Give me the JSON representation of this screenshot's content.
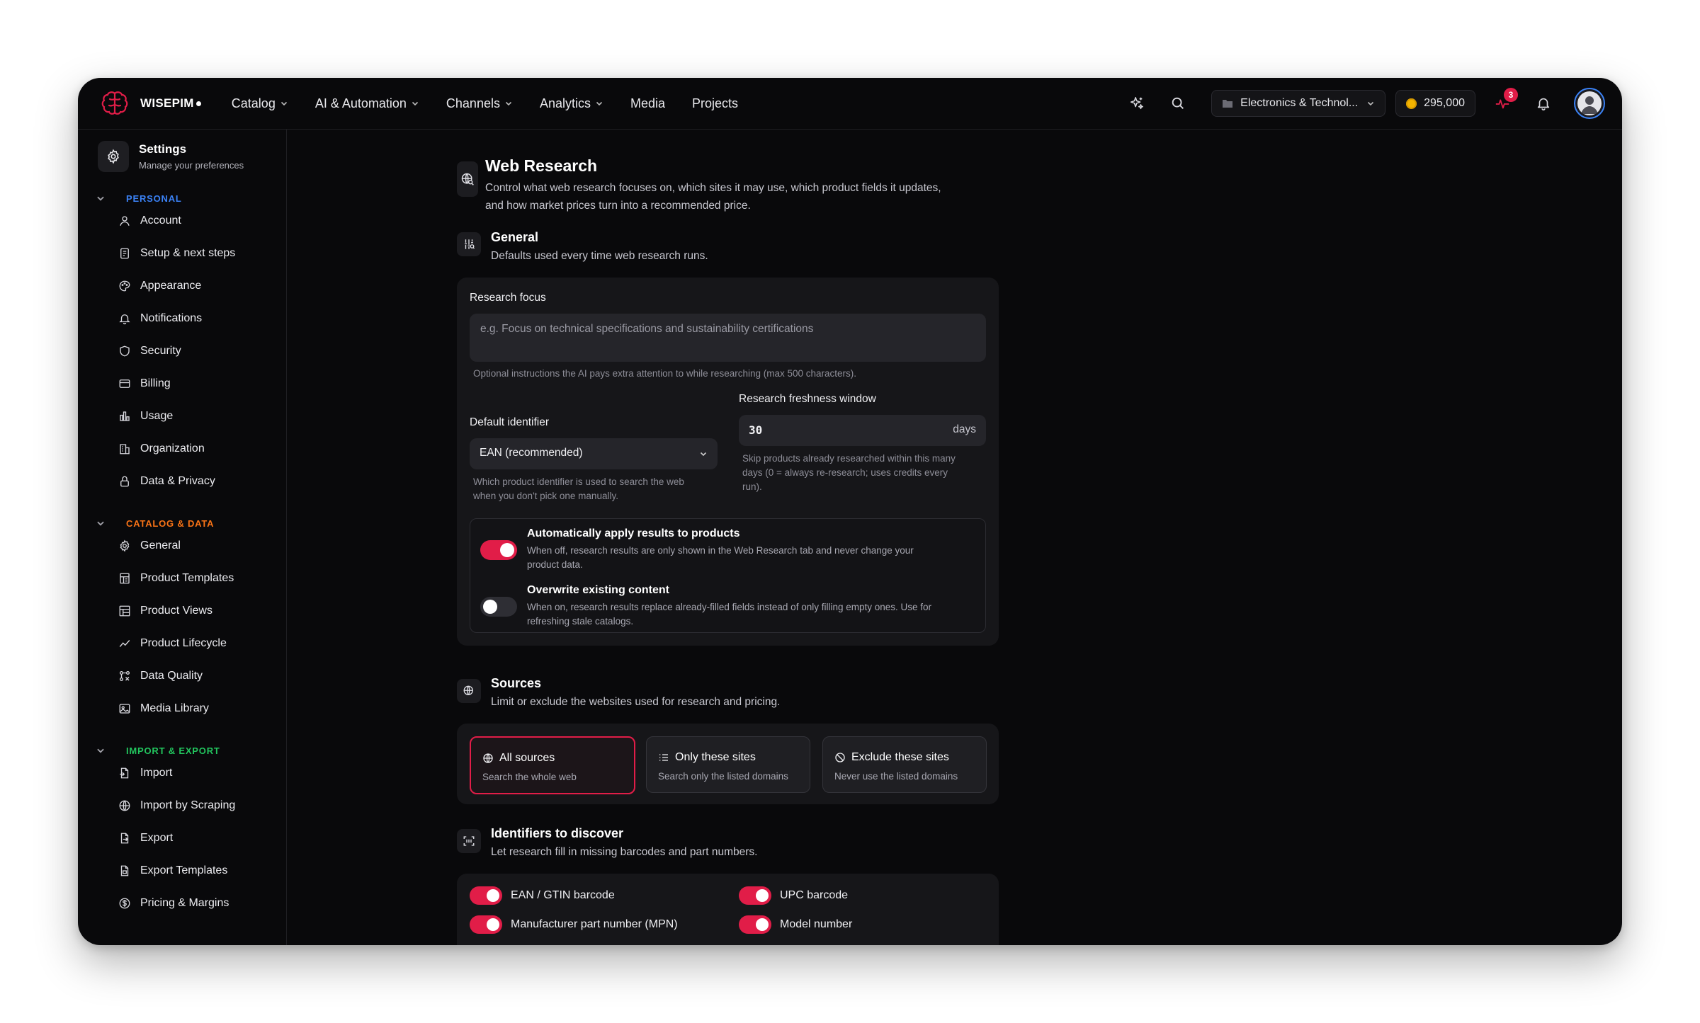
{
  "app": {
    "brand": "WISEPIM",
    "nav": [
      {
        "label": "Catalog",
        "dropdown": true
      },
      {
        "label": "AI & Automation",
        "dropdown": true
      },
      {
        "label": "Channels",
        "dropdown": true
      },
      {
        "label": "Analytics",
        "dropdown": true
      },
      {
        "label": "Media",
        "dropdown": false
      },
      {
        "label": "Projects",
        "dropdown": false
      }
    ],
    "org_selector": "Electronics & Technol...",
    "credits": "295,000",
    "notification_badge": "3",
    "accent_color": "#e11d48"
  },
  "sidebar": {
    "title": "Settings",
    "subtitle": "Manage your preferences",
    "sections": [
      {
        "label": "PERSONAL",
        "color": "#3b82f6",
        "items": [
          {
            "label": "Account",
            "icon": "user-icon"
          },
          {
            "label": "Setup & next steps",
            "icon": "clipboard-icon"
          },
          {
            "label": "Appearance",
            "icon": "palette-icon"
          },
          {
            "label": "Notifications",
            "icon": "bell-icon"
          },
          {
            "label": "Security",
            "icon": "shield-icon"
          },
          {
            "label": "Billing",
            "icon": "credit-card-icon"
          },
          {
            "label": "Usage",
            "icon": "bar-chart-icon"
          },
          {
            "label": "Organization",
            "icon": "building-icon"
          },
          {
            "label": "Data & Privacy",
            "icon": "lock-icon"
          }
        ]
      },
      {
        "label": "CATALOG & DATA",
        "color": "#f97316",
        "items": [
          {
            "label": "General",
            "icon": "gear-icon"
          },
          {
            "label": "Product Templates",
            "icon": "template-icon"
          },
          {
            "label": "Product Views",
            "icon": "layout-icon"
          },
          {
            "label": "Product Lifecycle",
            "icon": "trend-icon"
          },
          {
            "label": "Data Quality",
            "icon": "quality-icon"
          },
          {
            "label": "Media Library",
            "icon": "image-icon"
          }
        ]
      },
      {
        "label": "IMPORT & EXPORT",
        "color": "#22c55e",
        "items": [
          {
            "label": "Import",
            "icon": "file-import-icon"
          },
          {
            "label": "Import by Scraping",
            "icon": "globe-icon"
          },
          {
            "label": "Export",
            "icon": "file-export-icon"
          },
          {
            "label": "Export Templates",
            "icon": "file-template-icon"
          },
          {
            "label": "Pricing & Margins",
            "icon": "dollar-icon"
          }
        ]
      }
    ]
  },
  "page": {
    "title": "Web Research",
    "description_line1": "Control what web research focuses on, which sites it may use, which product fields it updates,",
    "description_line2": "and how market prices turn into a recommended price."
  },
  "general": {
    "title": "General",
    "subtitle": "Defaults used every time web research runs.",
    "research_focus_label": "Research focus",
    "research_focus_placeholder": "e.g. Focus on technical specifications and sustainability certifications",
    "research_focus_hint": "Optional instructions the AI pays extra attention to while researching (max 500 characters).",
    "default_identifier_label": "Default identifier",
    "default_identifier_value": "EAN (recommended)",
    "default_identifier_hint_line1": "Which product identifier is used to search the web",
    "default_identifier_hint_line2": "when you don't pick one manually.",
    "freshness_label": "Research freshness window",
    "freshness_value": "30",
    "freshness_unit": "days",
    "freshness_hint_line1": "Skip products already researched within this many",
    "freshness_hint_line2": "days (0 = always re-research; uses credits every",
    "freshness_hint_line3": "run).",
    "auto_apply_title": "Automatically apply results to products",
    "auto_apply_desc_line1": "When off, research results are only shown in the Web Research tab and never change your",
    "auto_apply_desc_line2": "product data.",
    "auto_apply_on": true,
    "overwrite_title": "Overwrite existing content",
    "overwrite_desc_line1": "When on, research results replace already-filled fields instead of only filling empty ones. Use for",
    "overwrite_desc_line2": "refreshing stale catalogs.",
    "overwrite_on": false
  },
  "sources": {
    "title": "Sources",
    "subtitle": "Limit or exclude the websites used for research and pricing.",
    "options": [
      {
        "title": "All sources",
        "desc": "Search the whole web",
        "icon": "globe-icon",
        "selected": true
      },
      {
        "title": "Only these sites",
        "desc": "Search only the listed domains",
        "icon": "list-icon",
        "selected": false
      },
      {
        "title": "Exclude these sites",
        "desc": "Never use the listed domains",
        "icon": "ban-icon",
        "selected": false
      }
    ]
  },
  "identifiers": {
    "title": "Identifiers to discover",
    "subtitle": "Let research fill in missing barcodes and part numbers.",
    "items": [
      {
        "label": "EAN / GTIN barcode",
        "on": true
      },
      {
        "label": "UPC barcode",
        "on": true
      },
      {
        "label": "Manufacturer part number (MPN)",
        "on": true
      },
      {
        "label": "Model number",
        "on": true
      }
    ]
  }
}
